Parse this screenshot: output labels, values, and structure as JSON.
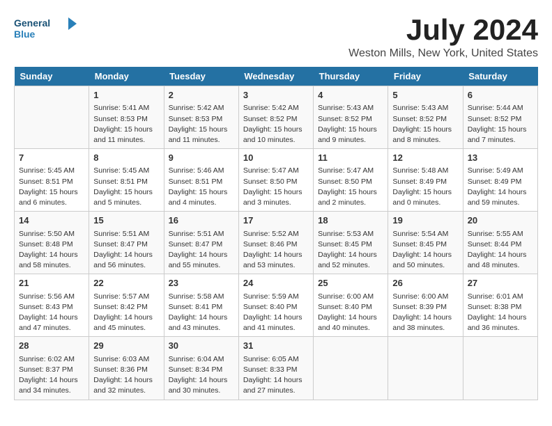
{
  "header": {
    "logo_general": "General",
    "logo_blue": "Blue",
    "month_title": "July 2024",
    "location": "Weston Mills, New York, United States"
  },
  "days_of_week": [
    "Sunday",
    "Monday",
    "Tuesday",
    "Wednesday",
    "Thursday",
    "Friday",
    "Saturday"
  ],
  "weeks": [
    [
      {
        "day": "",
        "info": ""
      },
      {
        "day": "1",
        "info": "Sunrise: 5:41 AM\nSunset: 8:53 PM\nDaylight: 15 hours\nand 11 minutes."
      },
      {
        "day": "2",
        "info": "Sunrise: 5:42 AM\nSunset: 8:53 PM\nDaylight: 15 hours\nand 11 minutes."
      },
      {
        "day": "3",
        "info": "Sunrise: 5:42 AM\nSunset: 8:52 PM\nDaylight: 15 hours\nand 10 minutes."
      },
      {
        "day": "4",
        "info": "Sunrise: 5:43 AM\nSunset: 8:52 PM\nDaylight: 15 hours\nand 9 minutes."
      },
      {
        "day": "5",
        "info": "Sunrise: 5:43 AM\nSunset: 8:52 PM\nDaylight: 15 hours\nand 8 minutes."
      },
      {
        "day": "6",
        "info": "Sunrise: 5:44 AM\nSunset: 8:52 PM\nDaylight: 15 hours\nand 7 minutes."
      }
    ],
    [
      {
        "day": "7",
        "info": "Sunrise: 5:45 AM\nSunset: 8:51 PM\nDaylight: 15 hours\nand 6 minutes."
      },
      {
        "day": "8",
        "info": "Sunrise: 5:45 AM\nSunset: 8:51 PM\nDaylight: 15 hours\nand 5 minutes."
      },
      {
        "day": "9",
        "info": "Sunrise: 5:46 AM\nSunset: 8:51 PM\nDaylight: 15 hours\nand 4 minutes."
      },
      {
        "day": "10",
        "info": "Sunrise: 5:47 AM\nSunset: 8:50 PM\nDaylight: 15 hours\nand 3 minutes."
      },
      {
        "day": "11",
        "info": "Sunrise: 5:47 AM\nSunset: 8:50 PM\nDaylight: 15 hours\nand 2 minutes."
      },
      {
        "day": "12",
        "info": "Sunrise: 5:48 AM\nSunset: 8:49 PM\nDaylight: 15 hours\nand 0 minutes."
      },
      {
        "day": "13",
        "info": "Sunrise: 5:49 AM\nSunset: 8:49 PM\nDaylight: 14 hours\nand 59 minutes."
      }
    ],
    [
      {
        "day": "14",
        "info": "Sunrise: 5:50 AM\nSunset: 8:48 PM\nDaylight: 14 hours\nand 58 minutes."
      },
      {
        "day": "15",
        "info": "Sunrise: 5:51 AM\nSunset: 8:47 PM\nDaylight: 14 hours\nand 56 minutes."
      },
      {
        "day": "16",
        "info": "Sunrise: 5:51 AM\nSunset: 8:47 PM\nDaylight: 14 hours\nand 55 minutes."
      },
      {
        "day": "17",
        "info": "Sunrise: 5:52 AM\nSunset: 8:46 PM\nDaylight: 14 hours\nand 53 minutes."
      },
      {
        "day": "18",
        "info": "Sunrise: 5:53 AM\nSunset: 8:45 PM\nDaylight: 14 hours\nand 52 minutes."
      },
      {
        "day": "19",
        "info": "Sunrise: 5:54 AM\nSunset: 8:45 PM\nDaylight: 14 hours\nand 50 minutes."
      },
      {
        "day": "20",
        "info": "Sunrise: 5:55 AM\nSunset: 8:44 PM\nDaylight: 14 hours\nand 48 minutes."
      }
    ],
    [
      {
        "day": "21",
        "info": "Sunrise: 5:56 AM\nSunset: 8:43 PM\nDaylight: 14 hours\nand 47 minutes."
      },
      {
        "day": "22",
        "info": "Sunrise: 5:57 AM\nSunset: 8:42 PM\nDaylight: 14 hours\nand 45 minutes."
      },
      {
        "day": "23",
        "info": "Sunrise: 5:58 AM\nSunset: 8:41 PM\nDaylight: 14 hours\nand 43 minutes."
      },
      {
        "day": "24",
        "info": "Sunrise: 5:59 AM\nSunset: 8:40 PM\nDaylight: 14 hours\nand 41 minutes."
      },
      {
        "day": "25",
        "info": "Sunrise: 6:00 AM\nSunset: 8:40 PM\nDaylight: 14 hours\nand 40 minutes."
      },
      {
        "day": "26",
        "info": "Sunrise: 6:00 AM\nSunset: 8:39 PM\nDaylight: 14 hours\nand 38 minutes."
      },
      {
        "day": "27",
        "info": "Sunrise: 6:01 AM\nSunset: 8:38 PM\nDaylight: 14 hours\nand 36 minutes."
      }
    ],
    [
      {
        "day": "28",
        "info": "Sunrise: 6:02 AM\nSunset: 8:37 PM\nDaylight: 14 hours\nand 34 minutes."
      },
      {
        "day": "29",
        "info": "Sunrise: 6:03 AM\nSunset: 8:36 PM\nDaylight: 14 hours\nand 32 minutes."
      },
      {
        "day": "30",
        "info": "Sunrise: 6:04 AM\nSunset: 8:34 PM\nDaylight: 14 hours\nand 30 minutes."
      },
      {
        "day": "31",
        "info": "Sunrise: 6:05 AM\nSunset: 8:33 PM\nDaylight: 14 hours\nand 27 minutes."
      },
      {
        "day": "",
        "info": ""
      },
      {
        "day": "",
        "info": ""
      },
      {
        "day": "",
        "info": ""
      }
    ]
  ]
}
